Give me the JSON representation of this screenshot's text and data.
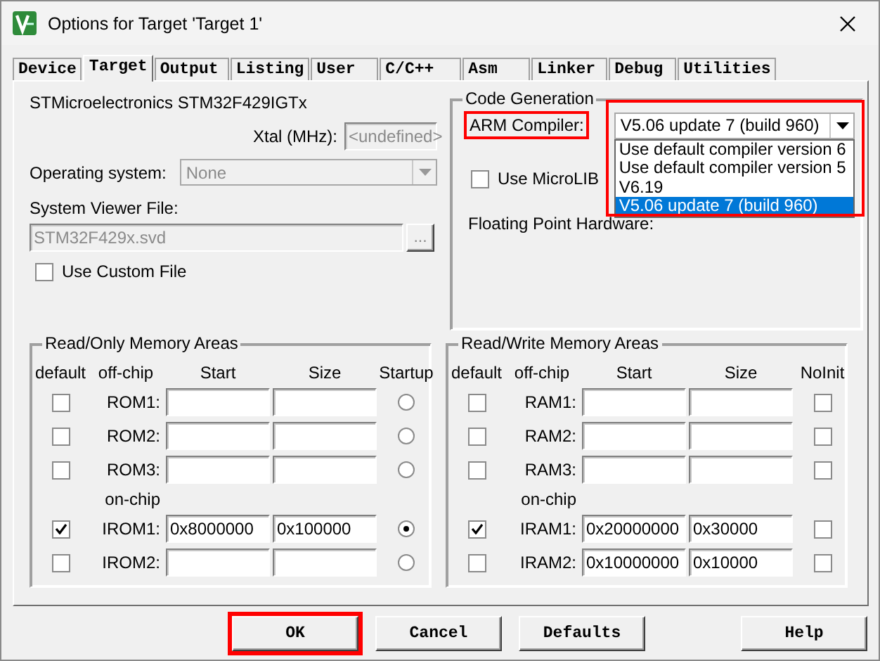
{
  "window": {
    "title": "Options for Target 'Target 1'"
  },
  "tabs": [
    {
      "label": "Device",
      "selected": false
    },
    {
      "label": "Target",
      "selected": true
    },
    {
      "label": "Output",
      "selected": false
    },
    {
      "label": "Listing",
      "selected": false
    },
    {
      "label": "User",
      "selected": false
    },
    {
      "label": "C/C++",
      "selected": false
    },
    {
      "label": "Asm",
      "selected": false
    },
    {
      "label": "Linker",
      "selected": false
    },
    {
      "label": "Debug",
      "selected": false
    },
    {
      "label": "Utilities",
      "selected": false
    }
  ],
  "device": {
    "name": "STMicroelectronics STM32F429IGTx",
    "xtal_label": "Xtal (MHz):",
    "xtal_value": "<undefined>",
    "os_label": "Operating system:",
    "os_value": "None",
    "svf_label": "System Viewer File:",
    "svf_value": "STM32F429x.svd",
    "browse": "...",
    "custom_file": {
      "label": "Use Custom File",
      "checked": false
    }
  },
  "code_generation": {
    "title": "Code Generation",
    "compiler_label": "ARM Compiler:",
    "compiler_label_annotated": true,
    "compiler_value": "V5.06 update 7 (build 960)",
    "compiler_annotated": true,
    "compiler_options": [
      {
        "label": "Use default compiler version 6",
        "selected": false
      },
      {
        "label": "Use default compiler version 5",
        "selected": false
      },
      {
        "label": "V6.19",
        "selected": false
      },
      {
        "label": "V5.06 update 7 (build 960)",
        "selected": true
      }
    ],
    "microlib": {
      "label": "Use MicroLIB",
      "checked": false
    },
    "fpu_label": "Floating Point Hardware:"
  },
  "memory_groups": [
    {
      "title": "Read/Only Memory Areas",
      "columns": [
        "default",
        "off-chip",
        "Start",
        "Size",
        "Startup"
      ],
      "section_label": "on-chip",
      "kind": "radio",
      "off_chip_rows": [
        {
          "name": "ROM1:",
          "default": false,
          "last": false
        },
        {
          "name": "ROM2:",
          "default": false,
          "last": false
        },
        {
          "name": "ROM3:",
          "default": false,
          "last": false
        }
      ],
      "on_chip_rows": [
        {
          "name": "IROM1:",
          "default": true,
          "start": "0x8000000",
          "size": "0x100000",
          "last": true
        },
        {
          "name": "IROM2:",
          "default": false,
          "last": false
        }
      ]
    },
    {
      "title": "Read/Write Memory Areas",
      "columns": [
        "default",
        "off-chip",
        "Start",
        "Size",
        "NoInit"
      ],
      "section_label": "on-chip",
      "kind": "check",
      "off_chip_rows": [
        {
          "name": "RAM1:",
          "default": false,
          "last": false
        },
        {
          "name": "RAM2:",
          "default": false,
          "last": false
        },
        {
          "name": "RAM3:",
          "default": false,
          "last": false
        }
      ],
      "on_chip_rows": [
        {
          "name": "IRAM1:",
          "default": true,
          "start": "0x20000000",
          "size": "0x30000",
          "last": false
        },
        {
          "name": "IRAM2:",
          "default": false,
          "start": "0x10000000",
          "size": "0x10000",
          "last": false
        }
      ]
    }
  ],
  "buttons": [
    {
      "label": "OK",
      "annotated": true
    },
    {
      "label": "Cancel",
      "annotated": false
    },
    {
      "label": "Defaults",
      "annotated": false
    },
    {
      "label": "Help",
      "annotated": false
    }
  ]
}
